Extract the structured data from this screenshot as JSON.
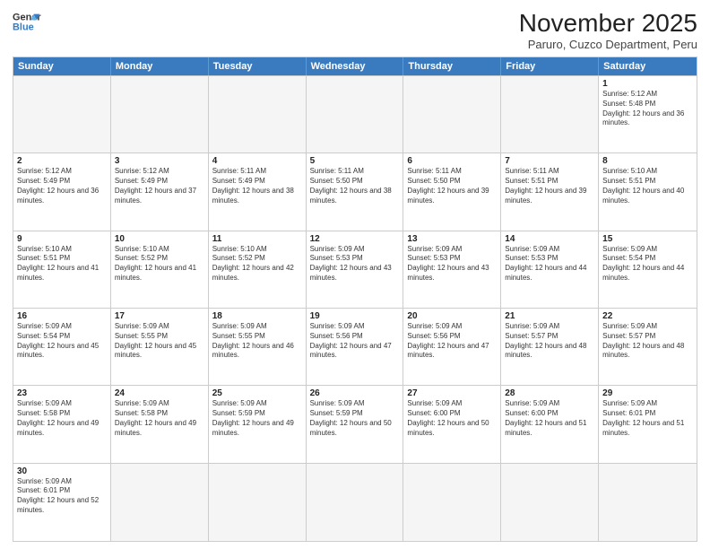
{
  "header": {
    "logo_general": "General",
    "logo_blue": "Blue",
    "month_title": "November 2025",
    "subtitle": "Paruro, Cuzco Department, Peru"
  },
  "days_of_week": [
    "Sunday",
    "Monday",
    "Tuesday",
    "Wednesday",
    "Thursday",
    "Friday",
    "Saturday"
  ],
  "weeks": [
    {
      "cells": [
        {
          "day": "",
          "empty": true,
          "text": ""
        },
        {
          "day": "",
          "empty": true,
          "text": ""
        },
        {
          "day": "",
          "empty": true,
          "text": ""
        },
        {
          "day": "",
          "empty": true,
          "text": ""
        },
        {
          "day": "",
          "empty": true,
          "text": ""
        },
        {
          "day": "",
          "empty": true,
          "text": ""
        },
        {
          "day": "1",
          "empty": false,
          "text": "Sunrise: 5:12 AM\nSunset: 5:48 PM\nDaylight: 12 hours and 36 minutes."
        }
      ]
    },
    {
      "cells": [
        {
          "day": "2",
          "empty": false,
          "text": "Sunrise: 5:12 AM\nSunset: 5:49 PM\nDaylight: 12 hours and 36 minutes."
        },
        {
          "day": "3",
          "empty": false,
          "text": "Sunrise: 5:12 AM\nSunset: 5:49 PM\nDaylight: 12 hours and 37 minutes."
        },
        {
          "day": "4",
          "empty": false,
          "text": "Sunrise: 5:11 AM\nSunset: 5:49 PM\nDaylight: 12 hours and 38 minutes."
        },
        {
          "day": "5",
          "empty": false,
          "text": "Sunrise: 5:11 AM\nSunset: 5:50 PM\nDaylight: 12 hours and 38 minutes."
        },
        {
          "day": "6",
          "empty": false,
          "text": "Sunrise: 5:11 AM\nSunset: 5:50 PM\nDaylight: 12 hours and 39 minutes."
        },
        {
          "day": "7",
          "empty": false,
          "text": "Sunrise: 5:11 AM\nSunset: 5:51 PM\nDaylight: 12 hours and 39 minutes."
        },
        {
          "day": "8",
          "empty": false,
          "text": "Sunrise: 5:10 AM\nSunset: 5:51 PM\nDaylight: 12 hours and 40 minutes."
        }
      ]
    },
    {
      "cells": [
        {
          "day": "9",
          "empty": false,
          "text": "Sunrise: 5:10 AM\nSunset: 5:51 PM\nDaylight: 12 hours and 41 minutes."
        },
        {
          "day": "10",
          "empty": false,
          "text": "Sunrise: 5:10 AM\nSunset: 5:52 PM\nDaylight: 12 hours and 41 minutes."
        },
        {
          "day": "11",
          "empty": false,
          "text": "Sunrise: 5:10 AM\nSunset: 5:52 PM\nDaylight: 12 hours and 42 minutes."
        },
        {
          "day": "12",
          "empty": false,
          "text": "Sunrise: 5:09 AM\nSunset: 5:53 PM\nDaylight: 12 hours and 43 minutes."
        },
        {
          "day": "13",
          "empty": false,
          "text": "Sunrise: 5:09 AM\nSunset: 5:53 PM\nDaylight: 12 hours and 43 minutes."
        },
        {
          "day": "14",
          "empty": false,
          "text": "Sunrise: 5:09 AM\nSunset: 5:53 PM\nDaylight: 12 hours and 44 minutes."
        },
        {
          "day": "15",
          "empty": false,
          "text": "Sunrise: 5:09 AM\nSunset: 5:54 PM\nDaylight: 12 hours and 44 minutes."
        }
      ]
    },
    {
      "cells": [
        {
          "day": "16",
          "empty": false,
          "text": "Sunrise: 5:09 AM\nSunset: 5:54 PM\nDaylight: 12 hours and 45 minutes."
        },
        {
          "day": "17",
          "empty": false,
          "text": "Sunrise: 5:09 AM\nSunset: 5:55 PM\nDaylight: 12 hours and 45 minutes."
        },
        {
          "day": "18",
          "empty": false,
          "text": "Sunrise: 5:09 AM\nSunset: 5:55 PM\nDaylight: 12 hours and 46 minutes."
        },
        {
          "day": "19",
          "empty": false,
          "text": "Sunrise: 5:09 AM\nSunset: 5:56 PM\nDaylight: 12 hours and 47 minutes."
        },
        {
          "day": "20",
          "empty": false,
          "text": "Sunrise: 5:09 AM\nSunset: 5:56 PM\nDaylight: 12 hours and 47 minutes."
        },
        {
          "day": "21",
          "empty": false,
          "text": "Sunrise: 5:09 AM\nSunset: 5:57 PM\nDaylight: 12 hours and 48 minutes."
        },
        {
          "day": "22",
          "empty": false,
          "text": "Sunrise: 5:09 AM\nSunset: 5:57 PM\nDaylight: 12 hours and 48 minutes."
        }
      ]
    },
    {
      "cells": [
        {
          "day": "23",
          "empty": false,
          "text": "Sunrise: 5:09 AM\nSunset: 5:58 PM\nDaylight: 12 hours and 49 minutes."
        },
        {
          "day": "24",
          "empty": false,
          "text": "Sunrise: 5:09 AM\nSunset: 5:58 PM\nDaylight: 12 hours and 49 minutes."
        },
        {
          "day": "25",
          "empty": false,
          "text": "Sunrise: 5:09 AM\nSunset: 5:59 PM\nDaylight: 12 hours and 49 minutes."
        },
        {
          "day": "26",
          "empty": false,
          "text": "Sunrise: 5:09 AM\nSunset: 5:59 PM\nDaylight: 12 hours and 50 minutes."
        },
        {
          "day": "27",
          "empty": false,
          "text": "Sunrise: 5:09 AM\nSunset: 6:00 PM\nDaylight: 12 hours and 50 minutes."
        },
        {
          "day": "28",
          "empty": false,
          "text": "Sunrise: 5:09 AM\nSunset: 6:00 PM\nDaylight: 12 hours and 51 minutes."
        },
        {
          "day": "29",
          "empty": false,
          "text": "Sunrise: 5:09 AM\nSunset: 6:01 PM\nDaylight: 12 hours and 51 minutes."
        }
      ]
    },
    {
      "cells": [
        {
          "day": "30",
          "empty": false,
          "text": "Sunrise: 5:09 AM\nSunset: 6:01 PM\nDaylight: 12 hours and 52 minutes."
        },
        {
          "day": "",
          "empty": true,
          "text": ""
        },
        {
          "day": "",
          "empty": true,
          "text": ""
        },
        {
          "day": "",
          "empty": true,
          "text": ""
        },
        {
          "day": "",
          "empty": true,
          "text": ""
        },
        {
          "day": "",
          "empty": true,
          "text": ""
        },
        {
          "day": "",
          "empty": true,
          "text": ""
        }
      ]
    }
  ]
}
